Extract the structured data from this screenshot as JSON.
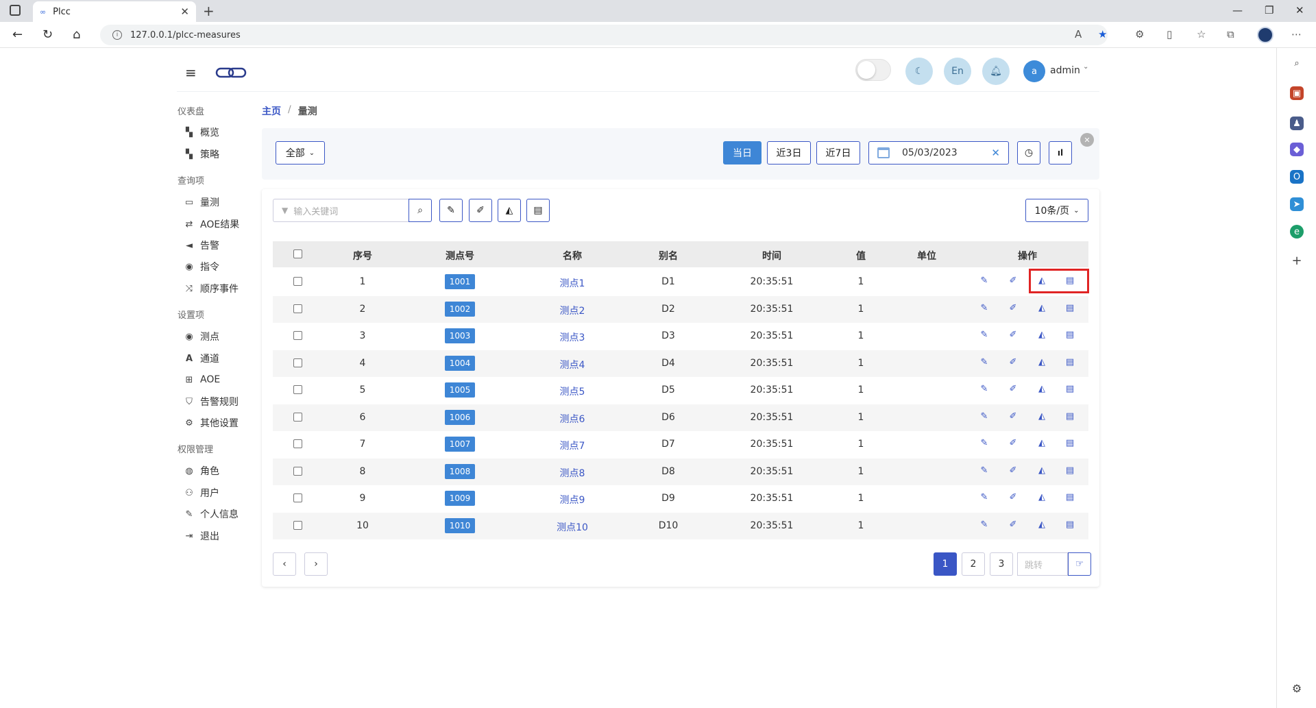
{
  "browser": {
    "tab_title": "Plcc",
    "url": "127.0.0.1/plcc-measures"
  },
  "header": {
    "lang_label": "En",
    "avatar_letter": "a",
    "username": "admin"
  },
  "sidebar": {
    "groups": [
      {
        "label": "仪表盘",
        "items": [
          {
            "label": "概览",
            "icon": "dashboard-icon"
          },
          {
            "label": "策略",
            "icon": "dashboard-icon"
          }
        ]
      },
      {
        "label": "查询项",
        "items": [
          {
            "label": "量测",
            "icon": "monitor-icon"
          },
          {
            "label": "AOE结果",
            "icon": "retweet-icon"
          },
          {
            "label": "告警",
            "icon": "bullhorn-icon"
          },
          {
            "label": "指令",
            "icon": "podcast-icon"
          },
          {
            "label": "顺序事件",
            "icon": "random-icon"
          }
        ]
      },
      {
        "label": "设置项",
        "items": [
          {
            "label": "测点",
            "icon": "podcast-icon"
          },
          {
            "label": "通道",
            "icon": "font-icon"
          },
          {
            "label": "AOE",
            "icon": "sitemap-icon"
          },
          {
            "label": "告警规则",
            "icon": "shield-icon"
          },
          {
            "label": "其他设置",
            "icon": "cogs-icon"
          }
        ]
      },
      {
        "label": "权限管理",
        "items": [
          {
            "label": "角色",
            "icon": "user-circle-icon"
          },
          {
            "label": "用户",
            "icon": "users-icon"
          },
          {
            "label": "个人信息",
            "icon": "edit-icon"
          },
          {
            "label": "退出",
            "icon": "sign-out-icon"
          }
        ]
      }
    ]
  },
  "breadcrumb": {
    "home": "主页",
    "separator": "/",
    "current": "量测"
  },
  "filter": {
    "category_select": "全部",
    "today": "当日",
    "last3": "近3日",
    "last7": "近7日",
    "date": "05/03/2023"
  },
  "toolbar": {
    "search_placeholder": "输入关键词",
    "page_size": "10条/页"
  },
  "table": {
    "headers": {
      "index": "序号",
      "point_no": "测点号",
      "name": "名称",
      "alias": "别名",
      "time": "时间",
      "value": "值",
      "unit": "单位",
      "ops": "操作"
    },
    "rows": [
      {
        "index": "1",
        "point_no": "1001",
        "name": "测点1",
        "alias": "D1",
        "time": "20:35:51",
        "value": "1",
        "unit": ""
      },
      {
        "index": "2",
        "point_no": "1002",
        "name": "测点2",
        "alias": "D2",
        "time": "20:35:51",
        "value": "1",
        "unit": ""
      },
      {
        "index": "3",
        "point_no": "1003",
        "name": "测点3",
        "alias": "D3",
        "time": "20:35:51",
        "value": "1",
        "unit": ""
      },
      {
        "index": "4",
        "point_no": "1004",
        "name": "测点4",
        "alias": "D4",
        "time": "20:35:51",
        "value": "1",
        "unit": ""
      },
      {
        "index": "5",
        "point_no": "1005",
        "name": "测点5",
        "alias": "D5",
        "time": "20:35:51",
        "value": "1",
        "unit": ""
      },
      {
        "index": "6",
        "point_no": "1006",
        "name": "测点6",
        "alias": "D6",
        "time": "20:35:51",
        "value": "1",
        "unit": ""
      },
      {
        "index": "7",
        "point_no": "1007",
        "name": "测点7",
        "alias": "D7",
        "time": "20:35:51",
        "value": "1",
        "unit": ""
      },
      {
        "index": "8",
        "point_no": "1008",
        "name": "测点8",
        "alias": "D8",
        "time": "20:35:51",
        "value": "1",
        "unit": ""
      },
      {
        "index": "9",
        "point_no": "1009",
        "name": "测点9",
        "alias": "D9",
        "time": "20:35:51",
        "value": "1",
        "unit": ""
      },
      {
        "index": "10",
        "point_no": "1010",
        "name": "测点10",
        "alias": "D10",
        "time": "20:35:51",
        "value": "1",
        "unit": ""
      }
    ]
  },
  "pagination": {
    "pages": [
      "1",
      "2",
      "3"
    ],
    "current": "1",
    "jump_placeholder": "跳转"
  },
  "colors": {
    "accent": "#3a56c5",
    "badge": "#3e86d6",
    "highlight": "#e02424"
  }
}
